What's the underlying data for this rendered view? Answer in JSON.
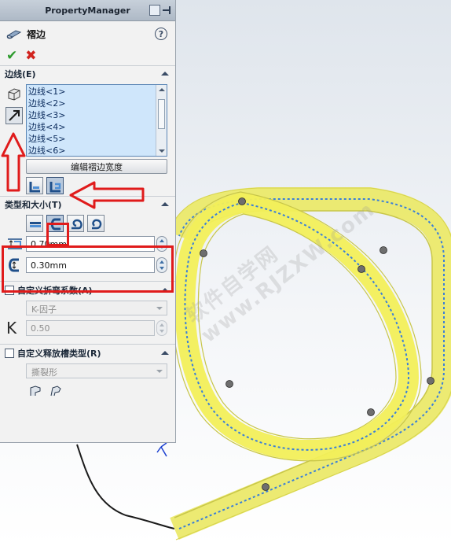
{
  "window": {
    "title": "PropertyManager",
    "feature_name": "褶边"
  },
  "edges_group": {
    "header": "边线(E)",
    "items": [
      "边线<1>",
      "边线<2>",
      "边线<3>",
      "边线<4>",
      "边线<5>",
      "边线<6>"
    ],
    "edit_width_button": "编辑褶边宽度"
  },
  "type_size_group": {
    "header": "类型和大小(T)",
    "length_value": "0.70mm",
    "gap_value": "0.30mm"
  },
  "bend_allowance_group": {
    "header": "自定义折弯系数(A)",
    "method_value": "K-因子",
    "k_symbol": "K",
    "k_value": "0.50"
  },
  "relief_group": {
    "header": "自定义释放槽类型(R)",
    "relief_value": "撕裂形"
  },
  "watermark": "软件自学网 www.RJZXW.com",
  "colors": {
    "panel_bg": "#f2f2f2",
    "selection_bg": "#cfe6fb",
    "annotation_red": "#e01b1b",
    "hem_yellow": "#f2ef5a",
    "hem_blue_dash": "#3a7fd8"
  },
  "icons": {
    "help": "help-icon",
    "ok": "check-icon",
    "cancel": "close-icon"
  }
}
